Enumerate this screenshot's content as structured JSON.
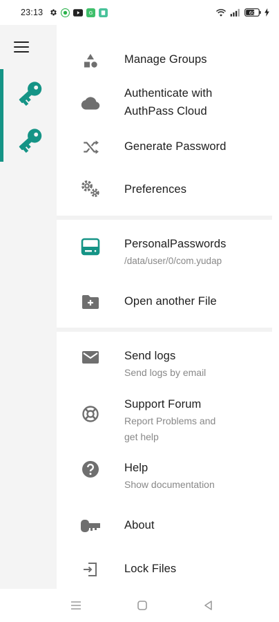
{
  "status_bar": {
    "time": "23:13",
    "battery": "60"
  },
  "drawer": {
    "items": [
      {
        "label": "Manage Groups",
        "icon": "shapes-icon"
      },
      {
        "label": "Authenticate with AuthPass Cloud",
        "line1": "Authenticate with",
        "line2": "AuthPass Cloud",
        "icon": "cloud-icon"
      },
      {
        "label": "Generate Password",
        "icon": "shuffle-icon"
      },
      {
        "label": "Preferences",
        "icon": "gears-icon"
      }
    ],
    "files": [
      {
        "label": "PersonalPasswords",
        "subtitle": "/data/user/0/com.yudap",
        "icon": "storage-icon",
        "accent": "#159486"
      },
      {
        "label": "Open another File",
        "icon": "folder-add-icon"
      }
    ],
    "support": [
      {
        "label": "Send logs",
        "subtitle": "Send logs by email",
        "icon": "mail-icon"
      },
      {
        "label": "Support Forum",
        "subtitle1": "Report Problems and",
        "subtitle2": "get help",
        "icon": "lifebuoy-icon"
      },
      {
        "label": "Help",
        "subtitle": "Show documentation",
        "icon": "help-icon"
      },
      {
        "label": "About",
        "icon": "key-icon"
      },
      {
        "label": "Lock Files",
        "icon": "exit-icon"
      }
    ]
  },
  "colors": {
    "accent": "#159486",
    "icon_grey": "#6f6f6f"
  }
}
